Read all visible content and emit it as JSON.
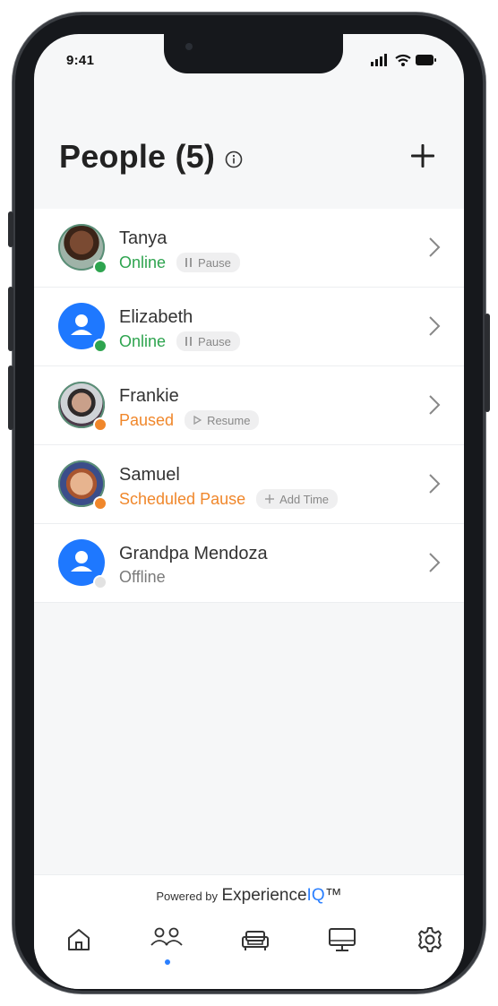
{
  "status_bar": {
    "time": "9:41"
  },
  "header": {
    "title": "People (5)"
  },
  "people": [
    {
      "name": "Tanya",
      "status": "Online",
      "status_type": "online",
      "action": "Pause",
      "action_icon": "pause-icon",
      "avatar": "photo"
    },
    {
      "name": "Elizabeth",
      "status": "Online",
      "status_type": "online",
      "action": "Pause",
      "action_icon": "pause-icon",
      "avatar": "default-user"
    },
    {
      "name": "Frankie",
      "status": "Paused",
      "status_type": "paused",
      "action": "Resume",
      "action_icon": "play-icon",
      "avatar": "photo"
    },
    {
      "name": "Samuel",
      "status": "Scheduled Pause",
      "status_type": "paused",
      "action": "Add Time",
      "action_icon": "plus-icon",
      "avatar": "photo"
    },
    {
      "name": "Grandpa Mendoza",
      "status": "Offline",
      "status_type": "offline",
      "action": "",
      "action_icon": "",
      "avatar": "default-user"
    }
  ],
  "footer": {
    "powered_by": "Powered by",
    "brand_prefix": "Experience",
    "brand_suffix": "IQ",
    "brand_mark": "™"
  },
  "tabbar": {
    "tabs": [
      "home-icon",
      "people-icon",
      "sofa-icon",
      "monitor-icon",
      "settings-icon"
    ],
    "active": "people-icon"
  },
  "colors": {
    "online": "#2ea44f",
    "paused": "#f0872b",
    "offline": "#7a7a7a",
    "accent": "#2a7fff",
    "avatar_blue": "#1e78ff"
  }
}
